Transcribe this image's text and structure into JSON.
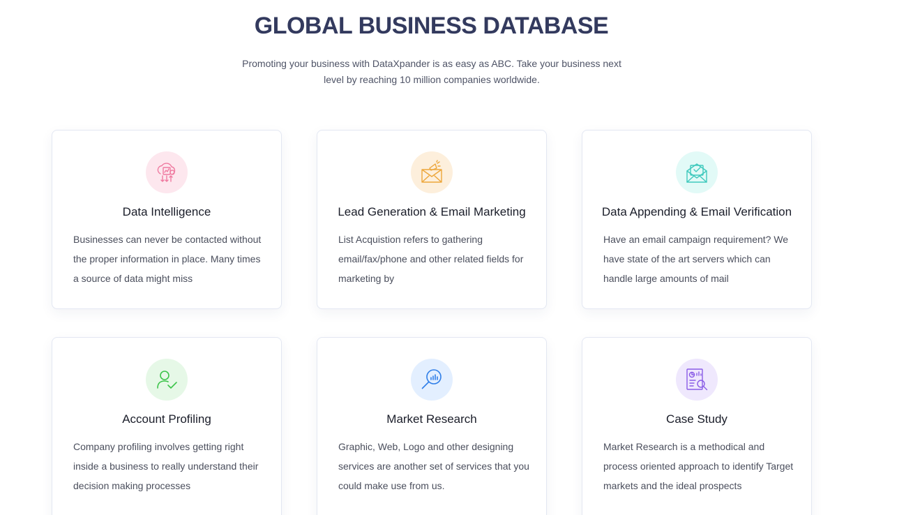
{
  "header": {
    "title": "GLOBAL BUSINESS DATABASE",
    "subtitle": "Promoting your business with DataXpander is as easy as ABC. Take your business next level by reaching 10 million companies worldwide."
  },
  "cards": [
    {
      "title": "Data Intelligence",
      "text": "Businesses can never be contacted without the proper information in place. Many times a source of data might miss",
      "icon": "cloud-data-icon",
      "icon_bg": "#fde7ee",
      "icon_color": "#ef7aa0"
    },
    {
      "title": "Lead Generation & Email Marketing",
      "text": "List Acquistion refers to gathering email/fax/phone and other related fields for marketing by",
      "icon": "megaphone-envelope-icon",
      "icon_bg": "#fdefdc",
      "icon_color": "#eda63a"
    },
    {
      "title": "Data Appending & Email Verification",
      "text": "Have an email campaign requirement? We have state of the art servers which can handle large amounts of mail",
      "icon": "verified-envelope-icon",
      "icon_bg": "#e2faf7",
      "icon_color": "#3fc9bd"
    },
    {
      "title": "Account Profiling",
      "text": "Company profiling involves getting right inside a business to really understand their decision making processes",
      "icon": "user-check-icon",
      "icon_bg": "#e6f8e7",
      "icon_color": "#3cc44a"
    },
    {
      "title": "Market Research",
      "text": "Graphic, Web, Logo and other designing services are another set of services that you could make use from us.",
      "icon": "magnifier-chart-icon",
      "icon_bg": "#e3efff",
      "icon_color": "#2f7ee8"
    },
    {
      "title": "Case Study",
      "text": "Market Research is a methodical and process oriented approach to identify Target markets and the ideal prospects",
      "icon": "report-search-icon",
      "icon_bg": "#efe8fd",
      "icon_color": "#8a5ce6"
    }
  ]
}
